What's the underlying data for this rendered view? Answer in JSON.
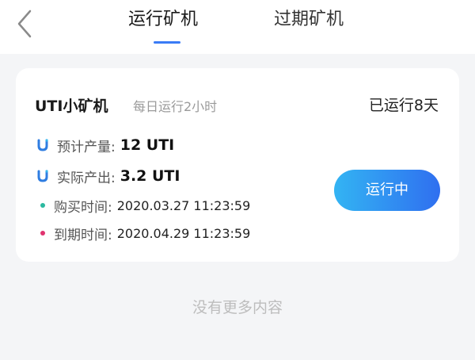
{
  "header": {
    "back_icon": "chevron-left-icon",
    "tabs": [
      {
        "label": "运行矿机",
        "active": true
      },
      {
        "label": "过期矿机",
        "active": false
      }
    ],
    "accent_color": "#3a7bf6"
  },
  "miner_card": {
    "name": "UTI小矿机",
    "subtitle": "每日运行2小时",
    "elapsed": "已运行8天",
    "expected_output": {
      "icon": "uti-logo-icon",
      "label": "预计产量:",
      "value": "12 UTI"
    },
    "actual_output": {
      "icon": "uti-logo-icon",
      "label": "实际产出:",
      "value": "3.2 UTI"
    },
    "purchase_time": {
      "label": "购买时间:",
      "value": "2020.03.27 11:23:59",
      "dot_color": "#2bb9a0"
    },
    "expire_time": {
      "label": "到期时间:",
      "value": "2020.04.29 11:23:59",
      "dot_color": "#e0336f"
    },
    "status_button": "运行中"
  },
  "footer_text": "没有更多内容"
}
